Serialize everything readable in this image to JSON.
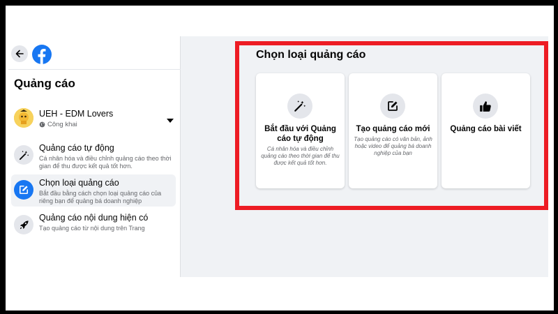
{
  "sidebar": {
    "title": "Quảng cáo",
    "account": {
      "name": "UEH - EDM Lovers",
      "visibility": "Công khai"
    },
    "items": [
      {
        "title": "Quảng cáo tự động",
        "desc": "Cá nhân hóa và điều chỉnh quảng cáo theo thời gian để thu được kết quả tốt hơn.",
        "icon": "magic-wand-icon",
        "active": false
      },
      {
        "title": "Chọn loại quảng cáo",
        "desc": "Bắt đầu bằng cách chọn loại quảng cáo của riêng bạn để quảng bá doanh nghiệp",
        "icon": "edit-icon",
        "active": true
      },
      {
        "title": "Quảng cáo nội dung hiện có",
        "desc": "Tạo quảng cáo từ nội dung trên Trang",
        "icon": "rocket-icon",
        "active": false
      }
    ]
  },
  "main": {
    "section_title": "Chọn loại quảng cáo",
    "cards": [
      {
        "title": "Bắt đầu với Quảng cáo tự động",
        "desc": "Cá nhân hóa và điều chỉnh quảng cáo theo thời gian để thu được kết quả tốt hơn.",
        "icon": "magic-wand-icon"
      },
      {
        "title": "Tạo quảng cáo mới",
        "desc": "Tạo quảng cáo có văn bản, ảnh hoặc video để quảng bá doanh nghiệp của bạn",
        "icon": "edit-icon"
      },
      {
        "title": "Quảng cáo bài viết",
        "desc": "",
        "icon": "thumbs-up-icon"
      }
    ]
  },
  "colors": {
    "accent": "#1877f2",
    "highlight": "#ed1c24",
    "background": "#f0f2f5",
    "text_secondary": "#65676b"
  }
}
